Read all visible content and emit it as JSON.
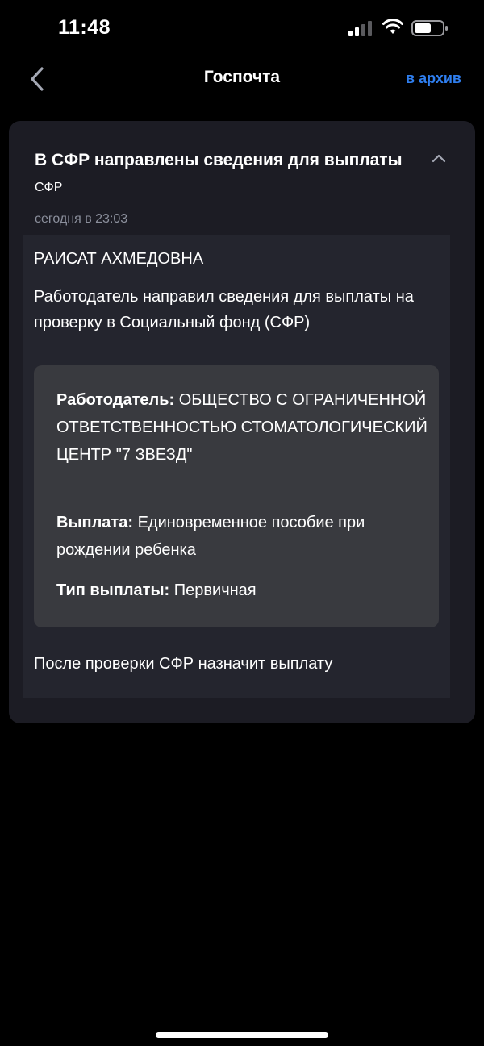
{
  "status_bar": {
    "time": "11:48",
    "icons": [
      "signal-icon",
      "wifi-icon",
      "battery-icon"
    ]
  },
  "header": {
    "title": "Госпочта",
    "back_icon": "chevron-left-icon",
    "archive_label": "в архив"
  },
  "message": {
    "title": "В СФР направлены сведения для выплаты",
    "sender": "СФР",
    "date": "сегодня в 23:03",
    "collapse_icon": "chevron-up-icon",
    "recipient": "РАИСАТ АХМЕДОВНА",
    "intro": "Работодатель направил сведения для выплаты на проверку в Социальный фонд (СФР)",
    "details": {
      "employer_label": "Работодатель:",
      "employer_value": "ОБЩЕСТВО С ОГРАНИЧЕННОЙ ОТВЕТСТВЕННОСТЬЮ СТОМАТОЛОГИЧЕСКИЙ ЦЕНТР \"7 ЗВЕЗД\"",
      "payment_label": "Выплата:",
      "payment_value": "Единовременное пособие при рождении ребенка",
      "type_label": "Тип выплаты:",
      "type_value": "Первичная"
    },
    "footer": "После проверки СФР назначит выплату"
  },
  "colors": {
    "background": "#000000",
    "card": "#1c1c24",
    "message_body": "#24252e",
    "details_box": "#393a3f",
    "accent": "#2f7ff0",
    "muted_text": "#8b8f9c"
  }
}
